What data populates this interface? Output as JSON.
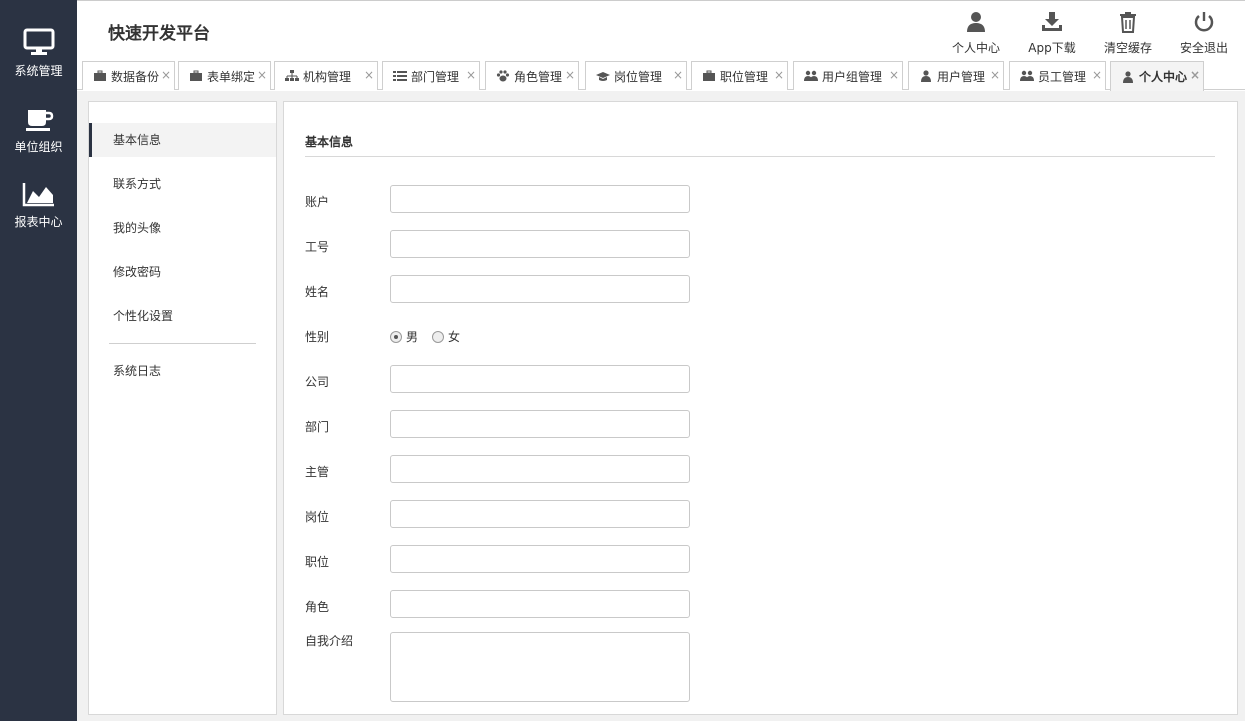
{
  "app": {
    "title": "快速开发平台"
  },
  "leftnav": {
    "items": [
      {
        "label": "系统管理",
        "icon": "monitor-icon"
      },
      {
        "label": "单位组织",
        "icon": "coffee-cup-icon"
      },
      {
        "label": "报表中心",
        "icon": "area-chart-icon"
      }
    ]
  },
  "top_actions": [
    {
      "label": "个人中心",
      "icon": "user-icon"
    },
    {
      "label": "App下载",
      "icon": "download-icon"
    },
    {
      "label": "清空缓存",
      "icon": "trash-icon"
    },
    {
      "label": "安全退出",
      "icon": "power-icon"
    }
  ],
  "tabs": [
    {
      "label": "数据备份",
      "icon": "briefcase-icon",
      "close": "×"
    },
    {
      "label": "表单绑定",
      "icon": "briefcase-icon",
      "close": "×"
    },
    {
      "label": "机构管理",
      "icon": "sitemap-icon",
      "close": "×"
    },
    {
      "label": "部门管理",
      "icon": "list-icon",
      "close": "×"
    },
    {
      "label": "角色管理",
      "icon": "paw-icon",
      "close": "×"
    },
    {
      "label": "岗位管理",
      "icon": "graduation-cap-icon",
      "close": "×"
    },
    {
      "label": "职位管理",
      "icon": "briefcase-icon",
      "close": "×"
    },
    {
      "label": "用户组管理",
      "icon": "users-icon",
      "close": "×"
    },
    {
      "label": "用户管理",
      "icon": "user-icon",
      "close": "×"
    },
    {
      "label": "员工管理",
      "icon": "users-icon",
      "close": "×"
    },
    {
      "label": "个人中心",
      "icon": "user-icon",
      "close": "×",
      "active": true
    }
  ],
  "side_menu": {
    "items": [
      "基本信息",
      "联系方式",
      "我的头像",
      "修改密码",
      "个性化设置"
    ],
    "extra": "系统日志",
    "active": "基本信息"
  },
  "form": {
    "section_title": "基本信息",
    "fields": {
      "account": {
        "label": "账户",
        "value": ""
      },
      "employee_no": {
        "label": "工号",
        "value": ""
      },
      "name": {
        "label": "姓名",
        "value": ""
      },
      "company": {
        "label": "公司",
        "value": ""
      },
      "department": {
        "label": "部门",
        "value": ""
      },
      "supervisor": {
        "label": "主管",
        "value": ""
      },
      "post": {
        "label": "岗位",
        "value": ""
      },
      "position": {
        "label": "职位",
        "value": ""
      },
      "role": {
        "label": "角色",
        "value": ""
      },
      "intro": {
        "label": "自我介绍",
        "value": ""
      }
    },
    "gender": {
      "label": "性别",
      "options": [
        "男",
        "女"
      ],
      "selected": "男"
    }
  },
  "colors": {
    "nav_bg": "#2b3343",
    "content_bg": "#f1f1f1"
  }
}
